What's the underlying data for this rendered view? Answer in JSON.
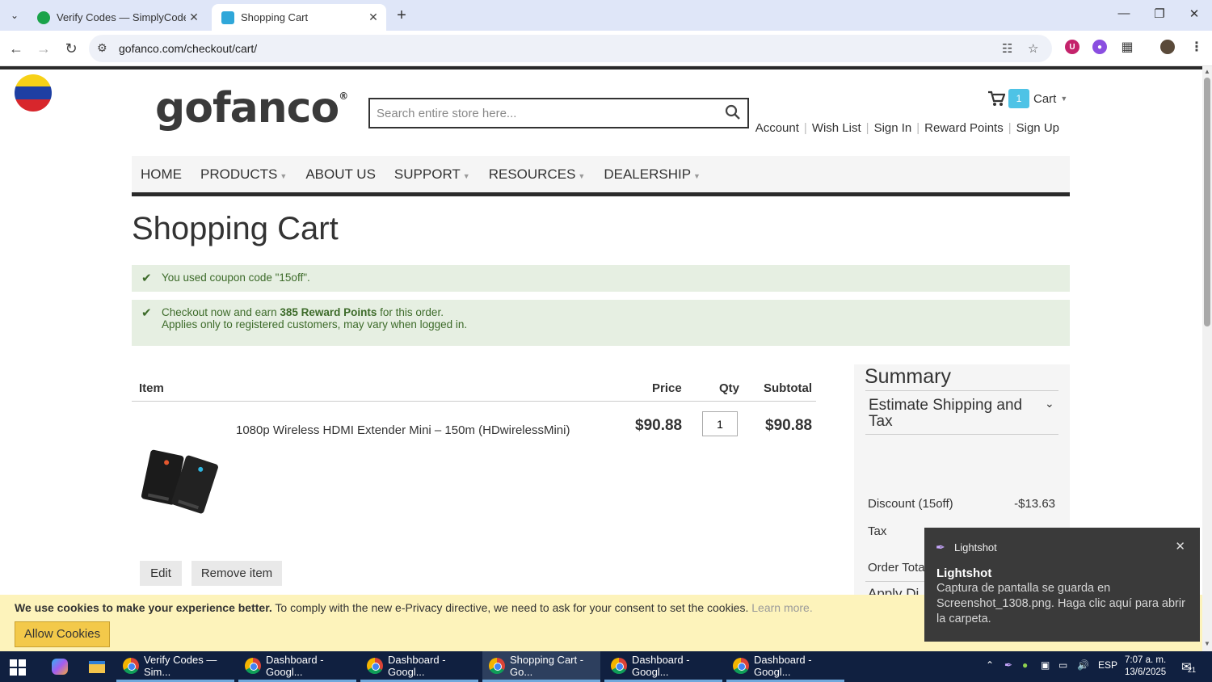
{
  "browser": {
    "tabs": [
      {
        "title": "Verify Codes — SimplyCodes",
        "active": false
      },
      {
        "title": "Shopping Cart",
        "active": true
      }
    ],
    "url": "gofanco.com/checkout/cart/"
  },
  "header": {
    "logo_text": "gofanco",
    "search_placeholder": "Search entire store here...",
    "cart_count": "1",
    "cart_label": "Cart",
    "links": [
      "Account",
      "Wish List",
      "Sign In",
      "Reward Points",
      "Sign Up"
    ]
  },
  "nav": {
    "items": [
      {
        "label": "HOME",
        "has_dropdown": false
      },
      {
        "label": "PRODUCTS",
        "has_dropdown": true
      },
      {
        "label": "ABOUT US",
        "has_dropdown": false
      },
      {
        "label": "SUPPORT",
        "has_dropdown": true
      },
      {
        "label": "RESOURCES",
        "has_dropdown": true
      },
      {
        "label": "DEALERSHIP",
        "has_dropdown": true
      }
    ]
  },
  "page": {
    "title": "Shopping Cart",
    "messages": {
      "coupon": "You used coupon code \"15off\".",
      "reward_pre": "Checkout now and earn ",
      "reward_bold": "385 Reward Points",
      "reward_post": " for this order.",
      "reward_line2": "Applies only to registered customers, may vary when logged in."
    }
  },
  "cart": {
    "headers": {
      "item": "Item",
      "price": "Price",
      "qty": "Qty",
      "subtotal": "Subtotal"
    },
    "items": [
      {
        "name": "1080p Wireless HDMI Extender Mini – 150m (HDwirelessMini)",
        "price": "$90.88",
        "qty": "1",
        "subtotal": "$90.88",
        "edit_label": "Edit",
        "remove_label": "Remove item"
      }
    ]
  },
  "summary": {
    "title": "Summary",
    "estimate_label": "Estimate Shipping and Tax",
    "discount_label": "Discount (15off)",
    "discount_value": "-$13.63",
    "tax_label": "Tax",
    "order_total_label": "Order Total",
    "apply_label": "Apply Di"
  },
  "cookie_bar": {
    "bold": "We use cookies to make your experience better.",
    "text": " To comply with the new e-Privacy directive, we need to ask for your consent to set the cookies. ",
    "learn_more": "Learn more.",
    "button": "Allow Cookies"
  },
  "notification": {
    "app": "Lightshot",
    "title": "Lightshot",
    "body": "Captura de pantalla se guarda en Screenshot_1308.png. Haga clic aquí para abrir la carpeta."
  },
  "taskbar": {
    "apps": [
      {
        "label": "Verify Codes — Sim..."
      },
      {
        "label": "Dashboard - Googl..."
      },
      {
        "label": "Dashboard - Googl..."
      },
      {
        "label": "Shopping Cart - Go..."
      },
      {
        "label": "Dashboard - Googl..."
      },
      {
        "label": "Dashboard - Googl..."
      }
    ],
    "language": "ESP",
    "time": "7:07 a. m.",
    "date": "13/6/2025",
    "notification_count": "21"
  },
  "colors": {
    "accent": "#4ec3e6",
    "success_bg": "#e6efe2",
    "success_text": "#3d6b2a",
    "cookie_bg": "#fdf3bb",
    "cookie_button": "#f3c94a"
  }
}
